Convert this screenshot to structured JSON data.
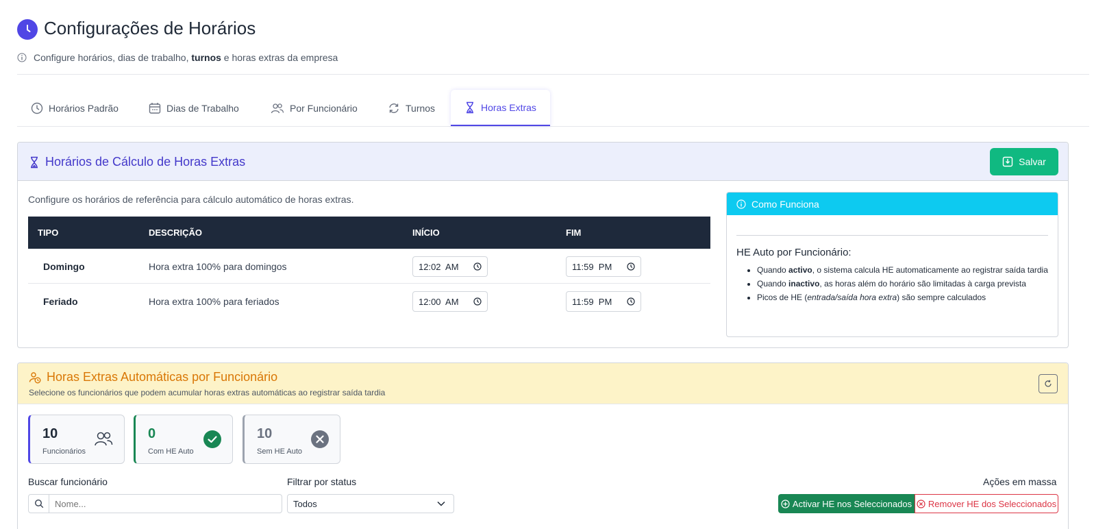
{
  "header": {
    "title": "Configurações de Horários",
    "subtitle_pre": "Configure horários, dias de trabalho, ",
    "subtitle_bold": "turnos",
    "subtitle_post": " e horas extras da empresa"
  },
  "tabs": [
    {
      "label": "Horários Padrão",
      "icon": "clock-icon"
    },
    {
      "label": "Dias de Trabalho",
      "icon": "calendar-icon"
    },
    {
      "label": "Por Funcionário",
      "icon": "users-icon"
    },
    {
      "label": "Turnos",
      "icon": "refresh-icon"
    },
    {
      "label": "Horas Extras",
      "icon": "hourglass-icon",
      "active": true
    }
  ],
  "overtime_schedule": {
    "title": "Horários de Cálculo de Horas Extras",
    "save_label": "Salvar",
    "description": "Configure os horários de referência para cálculo automático de horas extras.",
    "columns": [
      "TIPO",
      "DESCRIÇÃO",
      "INÍCIO",
      "FIM"
    ],
    "rows": [
      {
        "tipo": "Domingo",
        "descricao": "Hora extra 100% para domingos",
        "inicio": "12:02  AM",
        "fim": "11:59  PM"
      },
      {
        "tipo": "Feriado",
        "descricao": "Hora extra 100% para feriados",
        "inicio": "12:00  AM",
        "fim": "11:59  PM"
      }
    ]
  },
  "how_it_works": {
    "title": "Como Funciona",
    "subtitle": "HE Auto por Funcionário:",
    "item1_pre": "Quando ",
    "item1_bold": "activo",
    "item1_post": ", o sistema calcula HE automaticamente ao registrar saída tardia",
    "item2_pre": "Quando ",
    "item2_bold": "inactivo",
    "item2_post": ", as horas além do horário são limitadas à carga prevista",
    "item3_pre": "Picos de HE (",
    "item3_italic": "entrada/saída hora extra",
    "item3_post": ") são sempre calculados"
  },
  "auto_overtime": {
    "title": "Horas Extras Automáticas por Funcionário",
    "subtitle": "Selecione os funcionários que podem acumular horas extras automáticas ao registrar saída tardia",
    "stats": [
      {
        "value": "10",
        "label": "Funcionários",
        "color": "#4f46e5"
      },
      {
        "value": "0",
        "label": "Com HE Auto",
        "color": "#198754"
      },
      {
        "value": "10",
        "label": "Sem HE Auto",
        "color": "#6b7280"
      }
    ],
    "search_label": "Buscar funcionário",
    "search_placeholder": "Nome...",
    "filter_label": "Filtrar por status",
    "filter_value": "Todos",
    "bulk_label": "Ações em massa",
    "activate_label": "Activar HE nos Seleccionados",
    "remove_label": "Remover HE dos Seleccionados"
  }
}
